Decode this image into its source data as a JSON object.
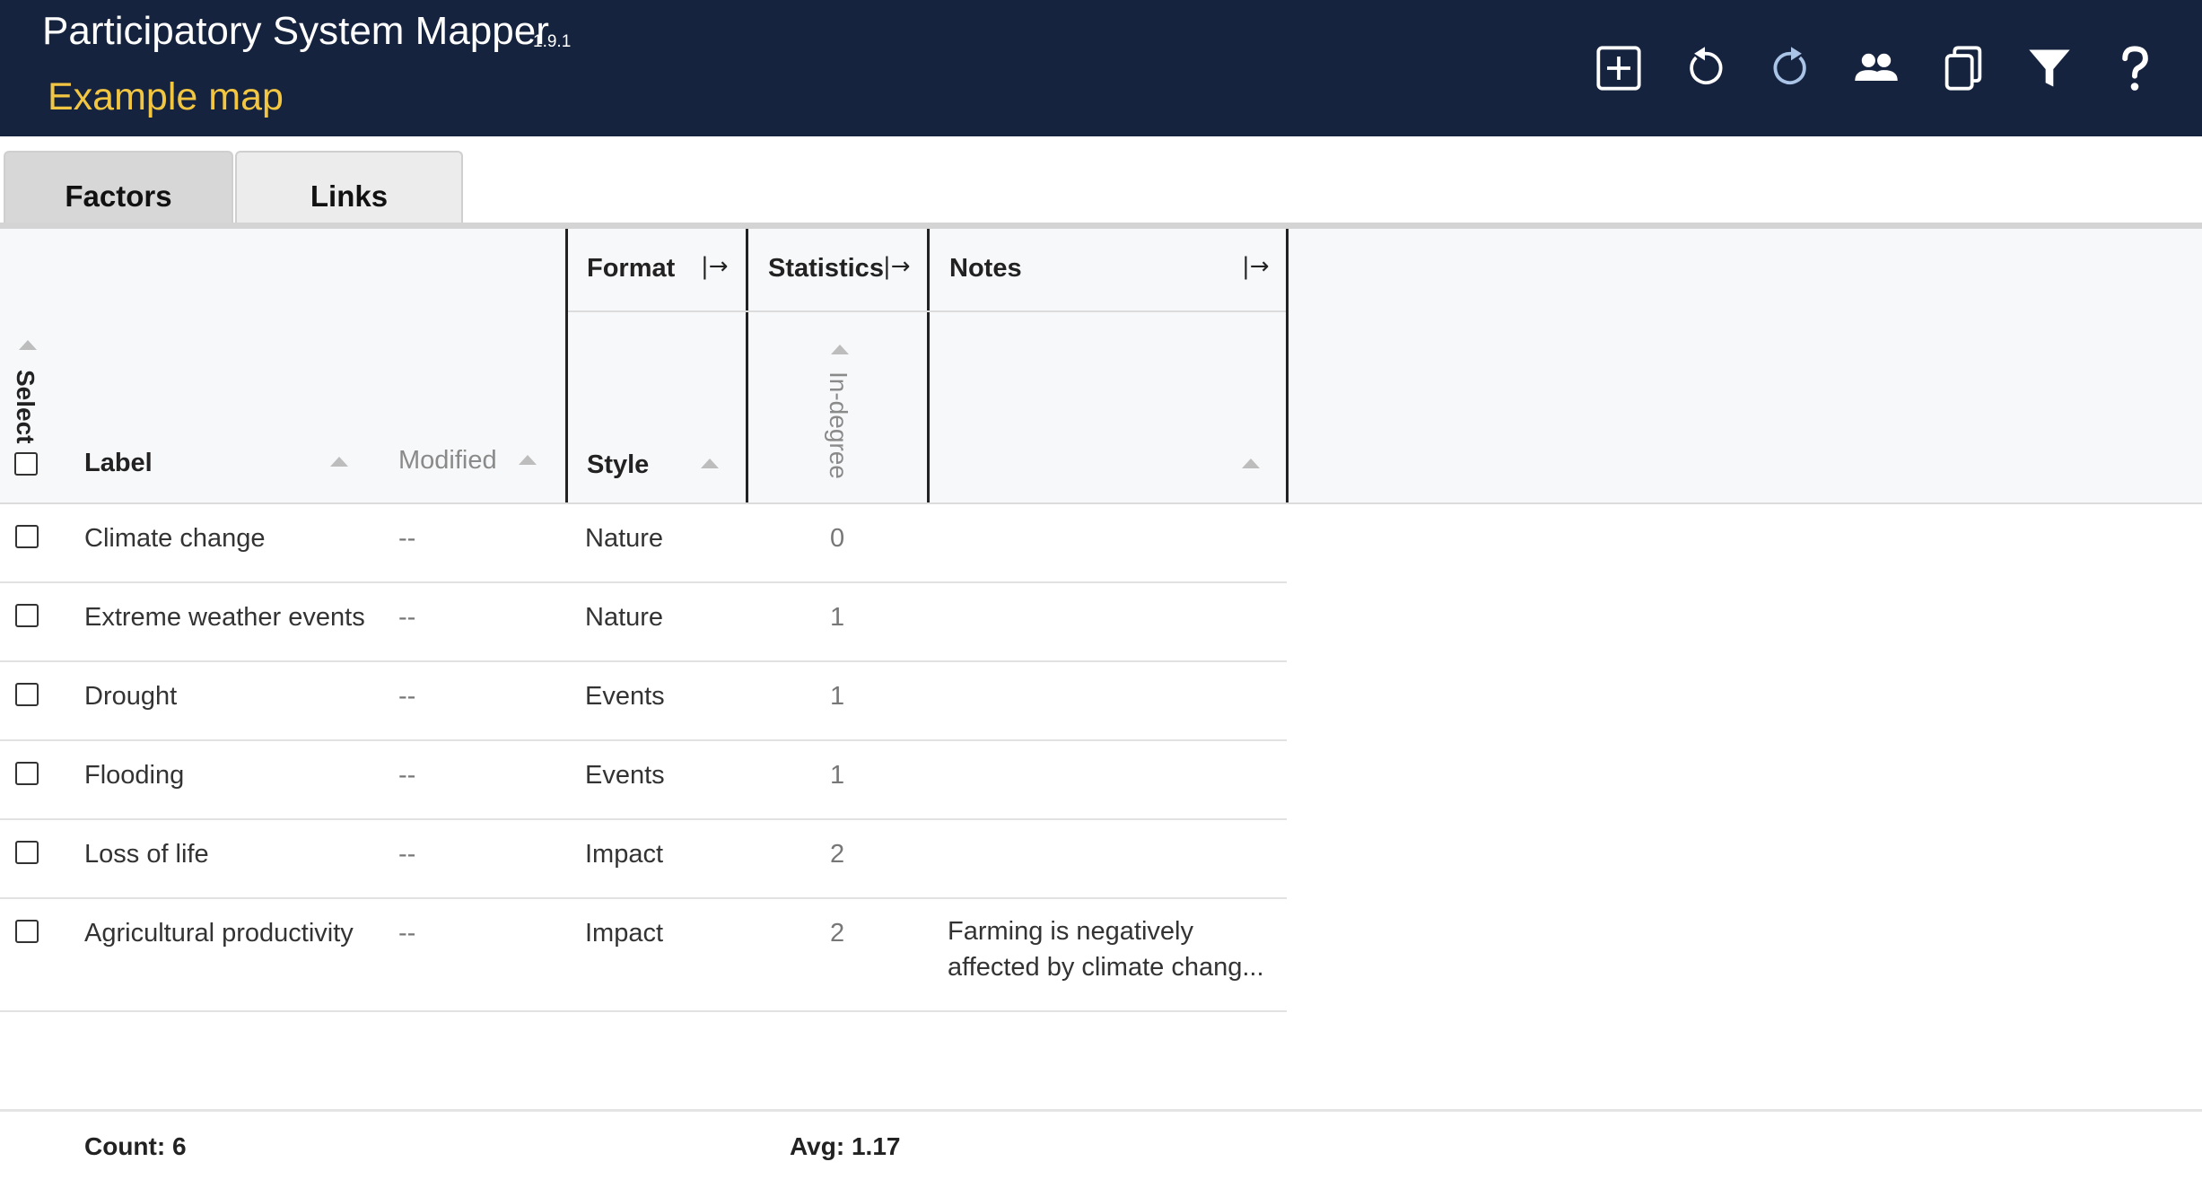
{
  "app": {
    "title": "Participatory System Mapper",
    "version": "1.9.1",
    "map_title": "Example map",
    "colors": {
      "header_bg": "#16233f",
      "map_title": "#f2c640"
    }
  },
  "toolbar": {
    "icons": [
      "add-icon",
      "undo-icon",
      "redo-icon",
      "users-icon",
      "copy-icon",
      "filter-icon",
      "help-icon"
    ]
  },
  "tabs": [
    {
      "label": "Factors",
      "active": true
    },
    {
      "label": "Links",
      "active": false
    }
  ],
  "table": {
    "groups": {
      "format": "Format",
      "statistics": "Statistics",
      "notes": "Notes"
    },
    "columns": {
      "select": "Select",
      "label": "Label",
      "modified": "Modified",
      "style": "Style",
      "indegree": "In-degree"
    },
    "rows": [
      {
        "label": "Climate change",
        "modified": "--",
        "style": "Nature",
        "indegree": "0",
        "notes": ""
      },
      {
        "label": "Extreme weather events",
        "modified": "--",
        "style": "Nature",
        "indegree": "1",
        "notes": ""
      },
      {
        "label": "Drought",
        "modified": "--",
        "style": "Events",
        "indegree": "1",
        "notes": ""
      },
      {
        "label": "Flooding",
        "modified": "--",
        "style": "Events",
        "indegree": "1",
        "notes": ""
      },
      {
        "label": "Loss of life",
        "modified": "--",
        "style": "Impact",
        "indegree": "2",
        "notes": ""
      },
      {
        "label": "Agricultural productivity",
        "modified": "--",
        "style": "Impact",
        "indegree": "2",
        "notes": "Farming is negatively affected by climate chang..."
      }
    ]
  },
  "footer": {
    "count": "Count: 6",
    "avg": "Avg: 1.17"
  }
}
